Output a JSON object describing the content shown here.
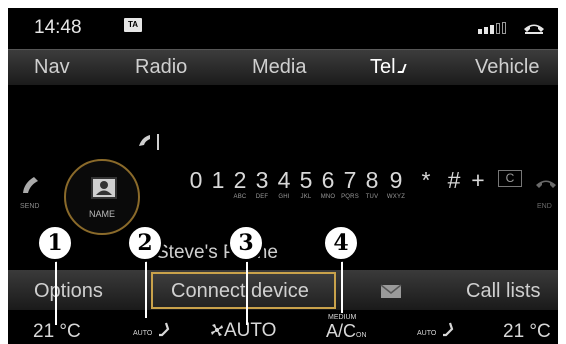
{
  "status": {
    "time": "14:48",
    "ta_badge": "TA"
  },
  "main_menu": {
    "items": [
      "Nav",
      "Radio",
      "Media",
      "Tel",
      "Vehicle"
    ],
    "active": "Tel"
  },
  "dialpad": {
    "send_label": "SEND",
    "end_label": "END",
    "name_label": "NAME",
    "keys": [
      {
        "digit": "0",
        "letters": ""
      },
      {
        "digit": "1",
        "letters": ""
      },
      {
        "digit": "2",
        "letters": "ABC"
      },
      {
        "digit": "3",
        "letters": "DEF"
      },
      {
        "digit": "4",
        "letters": "GHI"
      },
      {
        "digit": "5",
        "letters": "JKL"
      },
      {
        "digit": "6",
        "letters": "MNO"
      },
      {
        "digit": "7",
        "letters": "PQRS"
      },
      {
        "digit": "8",
        "letters": "TUV"
      },
      {
        "digit": "9",
        "letters": "WXYZ"
      },
      {
        "digit": "*",
        "letters": ""
      },
      {
        "digit": "#",
        "letters": ""
      },
      {
        "digit": "+",
        "letters": ""
      }
    ],
    "clear_label": "C"
  },
  "contact_partial": "Steve's Phone",
  "sub_menu": {
    "items": [
      "Options",
      "Connect device",
      "Call lists"
    ],
    "selected": "Connect device"
  },
  "climate": {
    "left_temp": "21 °C",
    "right_temp": "21 °C",
    "seat_auto_left": "AUTO",
    "seat_auto_right": "AUTO",
    "fan": "AUTO",
    "ac_level": "MEDIUM",
    "ac_label": "A/C",
    "ac_state": "ON"
  },
  "callouts": [
    "1",
    "2",
    "3",
    "4"
  ],
  "colors": {
    "highlight": "#c9a24b",
    "name_ring": "#8a6a2a",
    "background": "#000000"
  },
  "icons": [
    "phone-hangup-icon",
    "send-call-icon",
    "end-call-icon",
    "contact-card-icon",
    "envelope-icon",
    "fan-icon",
    "seat-airflow-icon",
    "signal-strength-icon"
  ]
}
